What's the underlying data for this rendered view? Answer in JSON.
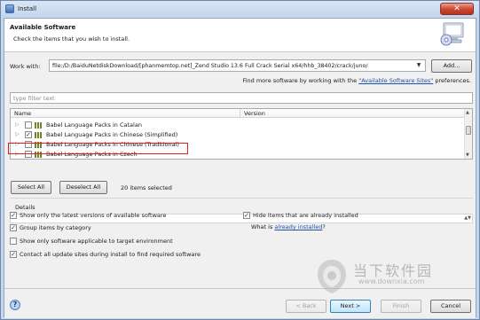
{
  "window": {
    "title": "Install",
    "close_label": "✕"
  },
  "header": {
    "title": "Available Software",
    "description": "Check the items that you wish to install."
  },
  "work_with": {
    "label": "Work with:",
    "value": "file:/D:/BaiduNetdiskDownload/[phanmemtop.net]_Zend Studio 13.6  Full Crack Serial x64/hhb_38402/crack/juno/",
    "add_label": "Add..."
  },
  "find_more": {
    "prefix": "Find more software by working with the",
    "link": "\"Available Software Sites\"",
    "suffix": "preferences."
  },
  "filter": {
    "placeholder": "type filter text"
  },
  "tree": {
    "columns": [
      "Name",
      "Version"
    ],
    "rows": [
      {
        "label": "Babel Language Packs in Catalan",
        "checked": false
      },
      {
        "label": "Babel Language Packs in Chinese (Simplified)",
        "checked": true
      },
      {
        "label": "Babel Language Packs in Chinese (Traditional)",
        "checked": false
      },
      {
        "label": "Babel Language Packs in Czech",
        "checked": false
      }
    ]
  },
  "selection": {
    "select_all": "Select All",
    "deselect_all": "Deselect All",
    "count_text": "20 items selected"
  },
  "details": {
    "label": "Details"
  },
  "options": {
    "latest_versions": {
      "label": "Show only the latest versions of available software",
      "checked": true
    },
    "group_by_category": {
      "label": "Group items by category",
      "checked": true
    },
    "applicable_only": {
      "label": "Show only software applicable to target environment",
      "checked": false
    },
    "contact_sites": {
      "label": "Contact all update sites during install to find required software",
      "checked": true
    },
    "hide_installed": {
      "label": "Hide items that are already installed",
      "checked": true
    },
    "what_is_prefix": "What is",
    "what_is_link": "already installed",
    "what_is_suffix": "?"
  },
  "buttons": {
    "back": "< Back",
    "next": "Next >",
    "finish": "Finish",
    "cancel": "Cancel"
  },
  "watermark": {
    "text": "当下软件园",
    "url": "www.downxia.com"
  },
  "colors": {
    "link": "#1f4fa8",
    "highlight_border": "#e02020",
    "titlebar": "#c5d7ee"
  }
}
